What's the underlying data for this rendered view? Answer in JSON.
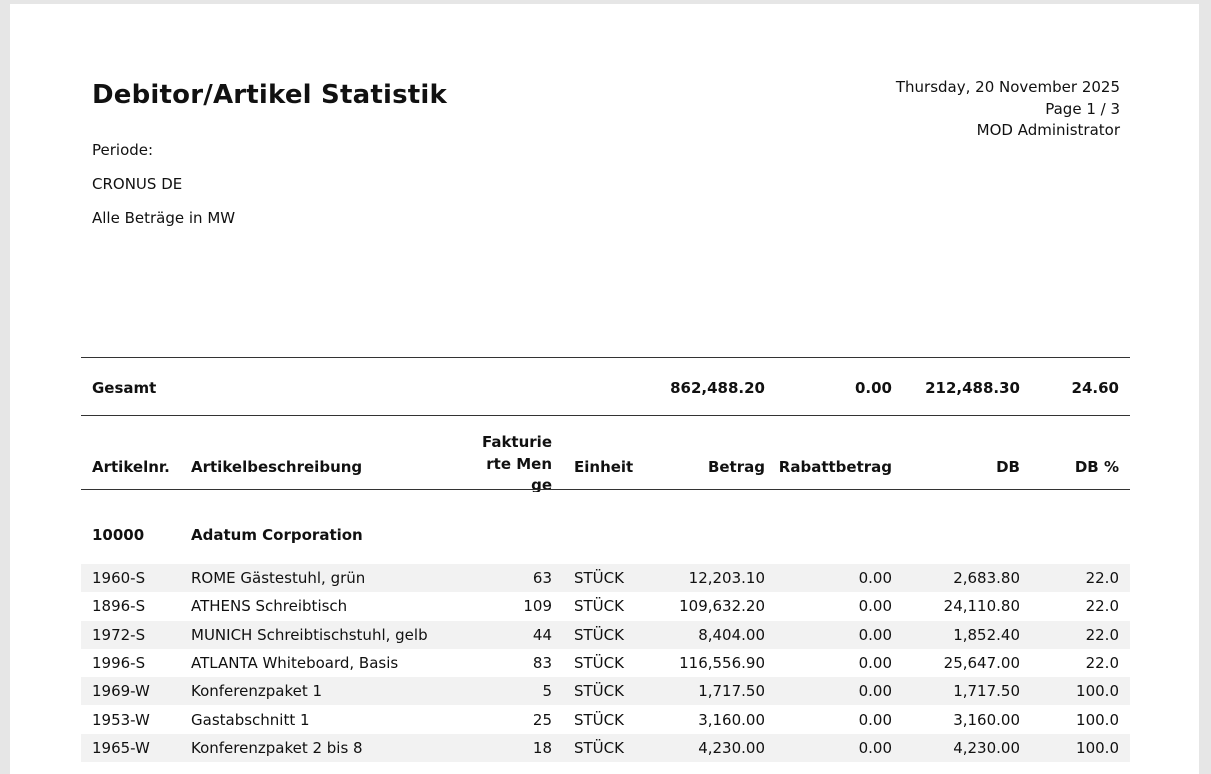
{
  "report": {
    "title": "Debitor/Artikel Statistik",
    "date": "Thursday, 20 November 2025",
    "page": "Page 1 / 3",
    "user": "MOD Administrator",
    "periode_label": "Periode:",
    "company": "CRONUS DE",
    "amounts_note": "Alle Beträge in MW"
  },
  "total": {
    "label": "Gesamt",
    "betrag": "862,488.20",
    "rabatt": "0.00",
    "db": "212,488.30",
    "db_pct": "24.60"
  },
  "columns": {
    "artikelnr": "Artikelnr.",
    "beschreibung": "Artikelbeschreibung",
    "menge": "Fakturierte Menge",
    "einheit": "Einheit",
    "betrag": "Betrag",
    "rabatt": "Rabattbetrag",
    "db": "DB",
    "db_pct": "DB %"
  },
  "customer": {
    "no": "10000",
    "name": "Adatum Corporation"
  },
  "rows": [
    {
      "nr": "1960-S",
      "desc": "ROME Gästestuhl, grün",
      "qty": "63",
      "unit": "STÜCK",
      "betrag": "12,203.10",
      "rabatt": "0.00",
      "db": "2,683.80",
      "pct": "22.0"
    },
    {
      "nr": "1896-S",
      "desc": "ATHENS Schreibtisch",
      "qty": "109",
      "unit": "STÜCK",
      "betrag": "109,632.20",
      "rabatt": "0.00",
      "db": "24,110.80",
      "pct": "22.0"
    },
    {
      "nr": "1972-S",
      "desc": "MUNICH Schreibtischstuhl, gelb",
      "qty": "44",
      "unit": "STÜCK",
      "betrag": "8,404.00",
      "rabatt": "0.00",
      "db": "1,852.40",
      "pct": "22.0"
    },
    {
      "nr": "1996-S",
      "desc": "ATLANTA Whiteboard, Basis",
      "qty": "83",
      "unit": "STÜCK",
      "betrag": "116,556.90",
      "rabatt": "0.00",
      "db": "25,647.00",
      "pct": "22.0"
    },
    {
      "nr": "1969-W",
      "desc": "Konferenzpaket 1",
      "qty": "5",
      "unit": "STÜCK",
      "betrag": "1,717.50",
      "rabatt": "0.00",
      "db": "1,717.50",
      "pct": "100.0"
    },
    {
      "nr": "1953-W",
      "desc": "Gastabschnitt 1",
      "qty": "25",
      "unit": "STÜCK",
      "betrag": "3,160.00",
      "rabatt": "0.00",
      "db": "3,160.00",
      "pct": "100.0"
    },
    {
      "nr": "1965-W",
      "desc": "Konferenzpaket 2 bis 8",
      "qty": "18",
      "unit": "STÜCK",
      "betrag": "4,230.00",
      "rabatt": "0.00",
      "db": "4,230.00",
      "pct": "100.0"
    }
  ]
}
